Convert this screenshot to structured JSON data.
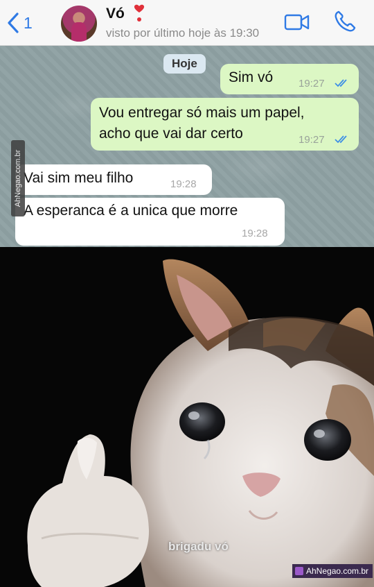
{
  "header": {
    "back_count": "1",
    "contact_name": "Vó",
    "last_seen": "visto por último hoje às 19:30"
  },
  "chat": {
    "date_label": "Hoje",
    "messages": [
      {
        "direction": "out",
        "text": "Sim vó",
        "time": "19:27",
        "read": true
      },
      {
        "direction": "out",
        "text": "Vou entregar só mais um papel,\nacho que vai dar certo",
        "time": "19:27",
        "read": true
      },
      {
        "direction": "in",
        "text": "Vai sim meu filho",
        "time": "19:28"
      },
      {
        "direction": "in",
        "text": "A esperanca é a unica que morre",
        "time": "19:28"
      }
    ]
  },
  "meme": {
    "caption": "brigadu vó"
  },
  "watermarks": {
    "side": "AhNegao.com.br",
    "corner": "AhNegao.com.br"
  },
  "colors": {
    "accent": "#2f7ae5",
    "outgoing_bubble": "#dcf7c4",
    "incoming_bubble": "#ffffff",
    "read_ticks": "#3c8ee6"
  },
  "icons": [
    "back-chevron-icon",
    "heart-icon",
    "video-call-icon",
    "phone-call-icon",
    "double-check-icon"
  ]
}
